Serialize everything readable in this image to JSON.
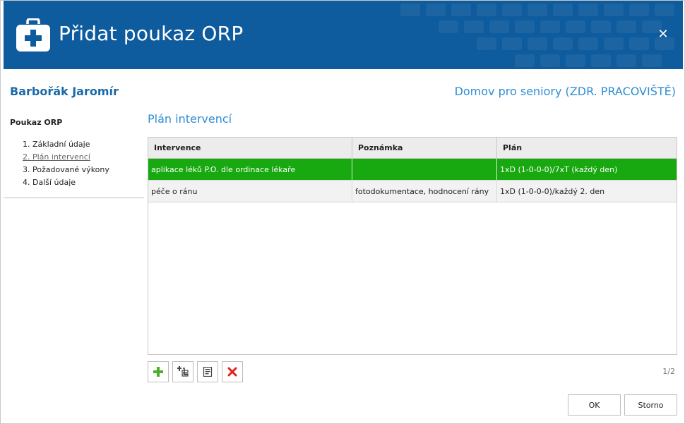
{
  "header": {
    "title": "Přidat poukaz ORP",
    "icon": "first-aid-kit-icon",
    "background": "#0e5b9d"
  },
  "patient": {
    "name": "Barbořák Jaromír",
    "facility": "Domov pro seniory (ZDR. PRACOVIŠTĚ)"
  },
  "sidebar": {
    "title": "Poukaz ORP",
    "items": [
      {
        "label": "1. Základní údaje"
      },
      {
        "label": "2. Plán intervencí"
      },
      {
        "label": "3. Požadované výkony"
      },
      {
        "label": "4. Další údaje"
      }
    ],
    "active_index": 1
  },
  "main": {
    "section_title": "Plán intervencí",
    "table": {
      "columns": [
        "Intervence",
        "Poznámka",
        "Plán"
      ],
      "rows": [
        [
          "aplikace léků P.O. dle ordinace lékaře",
          "",
          "1xD (1-0-0-0)/7xT (každý den)"
        ],
        [
          "péče o ránu",
          "fotodokumentace, hodnocení rány",
          "1xD (1-0-0-0)/každý 2. den"
        ]
      ],
      "selected_row": 0,
      "selection_color": "#18a80f"
    },
    "toolbar": {
      "icons": [
        "add-icon",
        "add-subitem-icon",
        "edit-icon",
        "delete-icon"
      ]
    },
    "pager": "1/2"
  },
  "footer": {
    "ok_label": "OK",
    "cancel_label": "Storno"
  }
}
